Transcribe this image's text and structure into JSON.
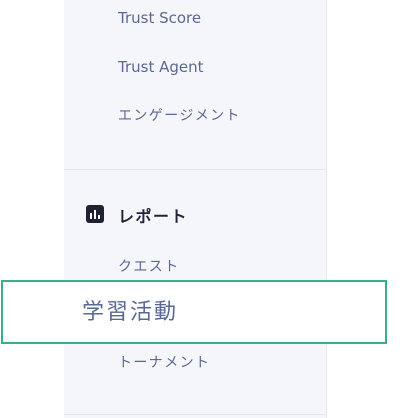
{
  "nav": {
    "items_top": [
      {
        "label": "Trust Score"
      },
      {
        "label": "Trust Agent"
      },
      {
        "label": "エンゲージメント"
      }
    ],
    "report_section": {
      "title": "レポート",
      "icon": "bar-chart-icon",
      "items": [
        {
          "label": "クエスト"
        },
        {
          "label": "学習活動"
        },
        {
          "label": "トーナメント"
        }
      ]
    }
  },
  "colors": {
    "sidebar_bg": "#f5f6fa",
    "nav_text": "#5a6894",
    "section_title": "#1f2437",
    "highlight_border": "#35b089"
  }
}
